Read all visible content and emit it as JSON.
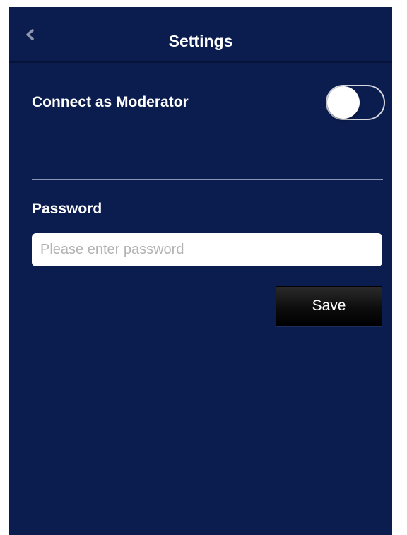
{
  "navbar": {
    "title": "Settings",
    "back_icon": "chevron-left-icon"
  },
  "moderator": {
    "label": "Connect as Moderator",
    "enabled": false
  },
  "password": {
    "label": "Password",
    "value": "",
    "placeholder": "Please enter password"
  },
  "actions": {
    "save_label": "Save"
  },
  "colors": {
    "background": "#0b1c4f",
    "text": "#ffffff",
    "divider": "#8b94b2",
    "button": "#000000"
  }
}
